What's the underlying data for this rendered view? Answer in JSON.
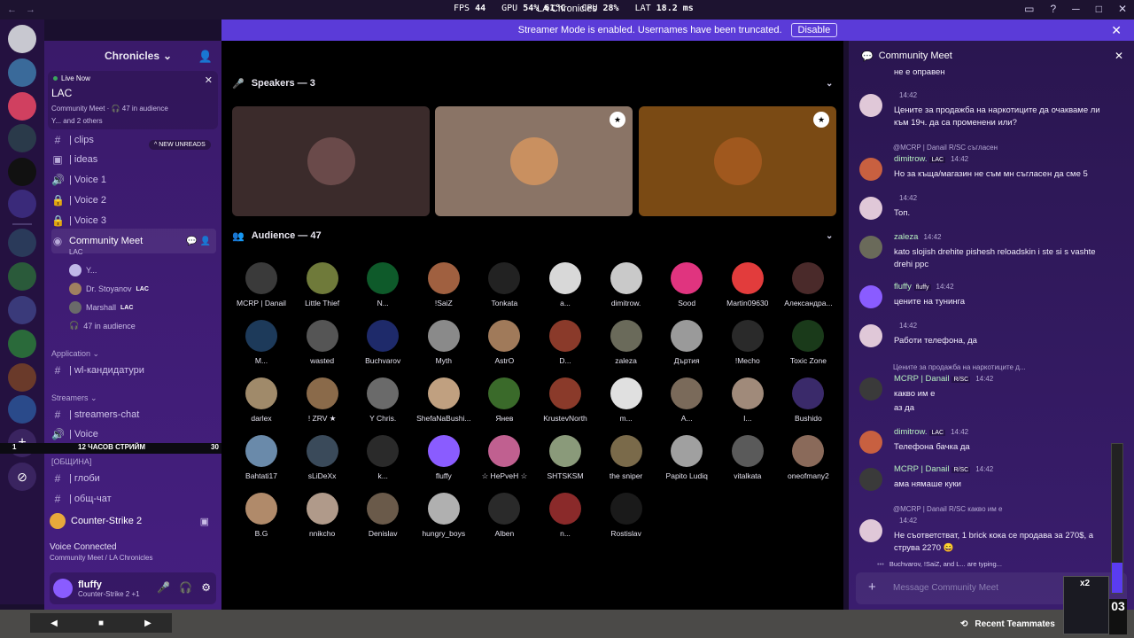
{
  "topbar": {
    "title": "LA Chronicles",
    "fps_label": "FPS",
    "fps": "44",
    "gpu_label": "GPU",
    "gpu": "54% 61°C",
    "cpu_label": "CPU",
    "cpu": "28%",
    "lat_label": "LAT",
    "lat": "18.2 ms"
  },
  "banner": {
    "text": "Streamer Mode is enabled. Usernames have been truncated.",
    "button": "Disable"
  },
  "server": {
    "name": "Chronicles",
    "live_label": "Live Now",
    "live_name": "LAC",
    "live_meta": "Community Meet · 🎧 47 in audience",
    "live_sub": "Y... and 2 others",
    "new_unreads": "NEW UNREADS"
  },
  "channels": [
    {
      "icon": "#",
      "label": "| clips"
    },
    {
      "icon": "▣",
      "label": "| ideas"
    },
    {
      "icon": "🔊",
      "label": "| Voice 1"
    },
    {
      "icon": "🔒",
      "label": "| Voice 2"
    },
    {
      "icon": "🔒",
      "label": "| Voice 3"
    }
  ],
  "community_meet": {
    "label": "Community Meet",
    "sub": "LAC",
    "members": [
      {
        "name": "Y...",
        "tag": ""
      },
      {
        "name": "Dr. Stoyanov",
        "tag": "LAC"
      },
      {
        "name": "Marshall",
        "tag": "LAC"
      }
    ],
    "audience_count": "47 in audience"
  },
  "categories": {
    "application": "Application",
    "wl": "| wl-кандидатури",
    "streamers": "Streamers",
    "streamers_chat": "| streamers-chat",
    "voice": "| Voice",
    "general": "[ОБЩИНА]",
    "globi": "| глоби",
    "obshtchat": "| общ-чат"
  },
  "stream_overlay": {
    "left": "1",
    "text": "12 ЧАСОВ СТРИЙМ",
    "right": "30"
  },
  "activity": {
    "game": "Counter-Strike 2"
  },
  "voice": {
    "status": "Voice Connected",
    "location": "Community Meet / LA Chronicles"
  },
  "user": {
    "name": "fluffy",
    "status": "Counter-Strike 2 +1"
  },
  "stage": {
    "speakers_title": "Speakers — 3",
    "audience_title": "Audience — 47"
  },
  "speakers": [
    {
      "color": "#3b2b2b",
      "avatar": "#6a4a4a",
      "badge": false
    },
    {
      "color": "#8a7466",
      "avatar": "#c99060",
      "badge": true
    },
    {
      "color": "#7a4a14",
      "avatar": "#a0581e",
      "badge": true
    }
  ],
  "audience": [
    {
      "name": "MCRP | Danail",
      "color": "#3a3a3a"
    },
    {
      "name": "Little Thief",
      "color": "#6f7a3a"
    },
    {
      "name": "N...",
      "color": "#0e5a2a"
    },
    {
      "name": "!SaiZ",
      "color": "#a06040"
    },
    {
      "name": "Tonkata",
      "color": "#222222"
    },
    {
      "name": "a...",
      "color": "#d8d8d8"
    },
    {
      "name": "dimitrow.",
      "color": "#c9c9c9"
    },
    {
      "name": "Sood",
      "color": "#e0347f"
    },
    {
      "name": "Martin09630",
      "color": "#e23c3c"
    },
    {
      "name": "Александра...",
      "color": "#4a2a2a"
    },
    {
      "name": "M...",
      "color": "#1d3a5a"
    },
    {
      "name": "wasted",
      "color": "#555555"
    },
    {
      "name": "Buchvarov",
      "color": "#1e2a6a"
    },
    {
      "name": "Myth",
      "color": "#8a8a8a"
    },
    {
      "name": "AstrO",
      "color": "#a07a5a"
    },
    {
      "name": "D...",
      "color": "#8a3a2a"
    },
    {
      "name": "zaleza",
      "color": "#6a6a5a"
    },
    {
      "name": "Дъртия",
      "color": "#9a9a9a"
    },
    {
      "name": "!Mecho",
      "color": "#2a2a2a"
    },
    {
      "name": "Toxic Zone",
      "color": "#1a3a1a"
    },
    {
      "name": "darlex",
      "color": "#a08a6a"
    },
    {
      "name": "! ZRV ★",
      "color": "#8a6a4a"
    },
    {
      "name": "Y Chris.",
      "color": "#6a6a6a"
    },
    {
      "name": "ShefaNaBushi...",
      "color": "#c0a080"
    },
    {
      "name": "Янев",
      "color": "#3a6a2a"
    },
    {
      "name": "KrustevNorth",
      "color": "#8a3a2a"
    },
    {
      "name": "m...",
      "color": "#e0e0e0"
    },
    {
      "name": "A...",
      "color": "#7a6a5a"
    },
    {
      "name": "I...",
      "color": "#a08a7a"
    },
    {
      "name": "Bushido",
      "color": "#3a2a6a"
    },
    {
      "name": "Bahtati17",
      "color": "#6a8aaa"
    },
    {
      "name": "sLiDeXx",
      "color": "#3a4a5a"
    },
    {
      "name": "k...",
      "color": "#2a2a2a"
    },
    {
      "name": "fluffy",
      "color": "#8a5cff"
    },
    {
      "name": "☆ HePveH ☆",
      "color": "#c06090"
    },
    {
      "name": "SHTSKSM",
      "color": "#8a9a7a"
    },
    {
      "name": "the sniper",
      "color": "#7a6a4a"
    },
    {
      "name": "Papito Ludiq",
      "color": "#a0a0a0"
    },
    {
      "name": "vitalkata",
      "color": "#5a5a5a"
    },
    {
      "name": "oneofmany2",
      "color": "#8a6a5a"
    },
    {
      "name": "B.G",
      "color": "#b08a6a"
    },
    {
      "name": "nnikcho",
      "color": "#b09a8a"
    },
    {
      "name": "Denislav",
      "color": "#6a5a4a"
    },
    {
      "name": "hungry_boys",
      "color": "#b0b0b0"
    },
    {
      "name": "Alben",
      "color": "#2a2a2a"
    },
    {
      "name": "n...",
      "color": "#8a2a2a"
    },
    {
      "name": "Rostislav",
      "color": "#1a1a1a"
    }
  ],
  "chat": {
    "title": "Community Meet",
    "top_text": "не е оправен",
    "messages": [
      {
        "name": "",
        "tag": "",
        "time": "14:42",
        "text": "Цените за продажба на наркотиците да очакваме ли към 19ч. да са променени или?",
        "color": "#e0c8d8",
        "reply": ""
      },
      {
        "name": "dimitrow.",
        "tag": "LAC",
        "time": "14:42",
        "text": "Но за къща/магазин не съм мн съгласен да сме 5",
        "color": "#c86040",
        "reply": "@MCRP | Danail  R/SC  съгласен"
      },
      {
        "name": "",
        "tag": "",
        "time": "14:42",
        "text": "Топ.",
        "color": "#e0c8d8",
        "reply": ""
      },
      {
        "name": "zaleza",
        "tag": "",
        "time": "14:42",
        "text": "kato slojish drehite pishesh reloadskin i ste si s vashte drehi ppc",
        "color": "#6a6a5a",
        "reply": ""
      },
      {
        "name": "fluffy",
        "tag": "fluffy",
        "time": "14:42",
        "text": "цените на тунинга",
        "color": "#8a5cff",
        "reply": ""
      },
      {
        "name": "",
        "tag": "",
        "time": "14:42",
        "text": "Работи телефона, да",
        "color": "#e0c8d8",
        "reply": ""
      },
      {
        "name": "MCRP | Danail",
        "tag": "R/SC",
        "time": "14:42",
        "text": "какво им е",
        "text2": "аз да",
        "color": "#3a3a3a",
        "reply": "Цените за продажба на наркотиците д..."
      },
      {
        "name": "dimitrow.",
        "tag": "LAC",
        "time": "14:42",
        "text": "Телефона бачка да",
        "color": "#c86040",
        "reply": ""
      },
      {
        "name": "MCRP | Danail",
        "tag": "R/SC",
        "time": "14:42",
        "text": "ама нямаше куки",
        "color": "#3a3a3a",
        "reply": ""
      },
      {
        "name": "",
        "tag": "",
        "time": "14:42",
        "text": "Не съответстват, 1 brick кока се продава за 270$, а струва 2270 😄",
        "color": "#e0c8d8",
        "reply": "@MCRP | Danail  R/SC  какво им е"
      }
    ],
    "typing": "Buchvarov, !SaiZ, and L... are typing...",
    "input_placeholder": "Message Community Meet"
  },
  "bottom": {
    "recent": "Recent Teammates",
    "x2": "x2",
    "score": "03",
    "vol_level": 0.2
  }
}
